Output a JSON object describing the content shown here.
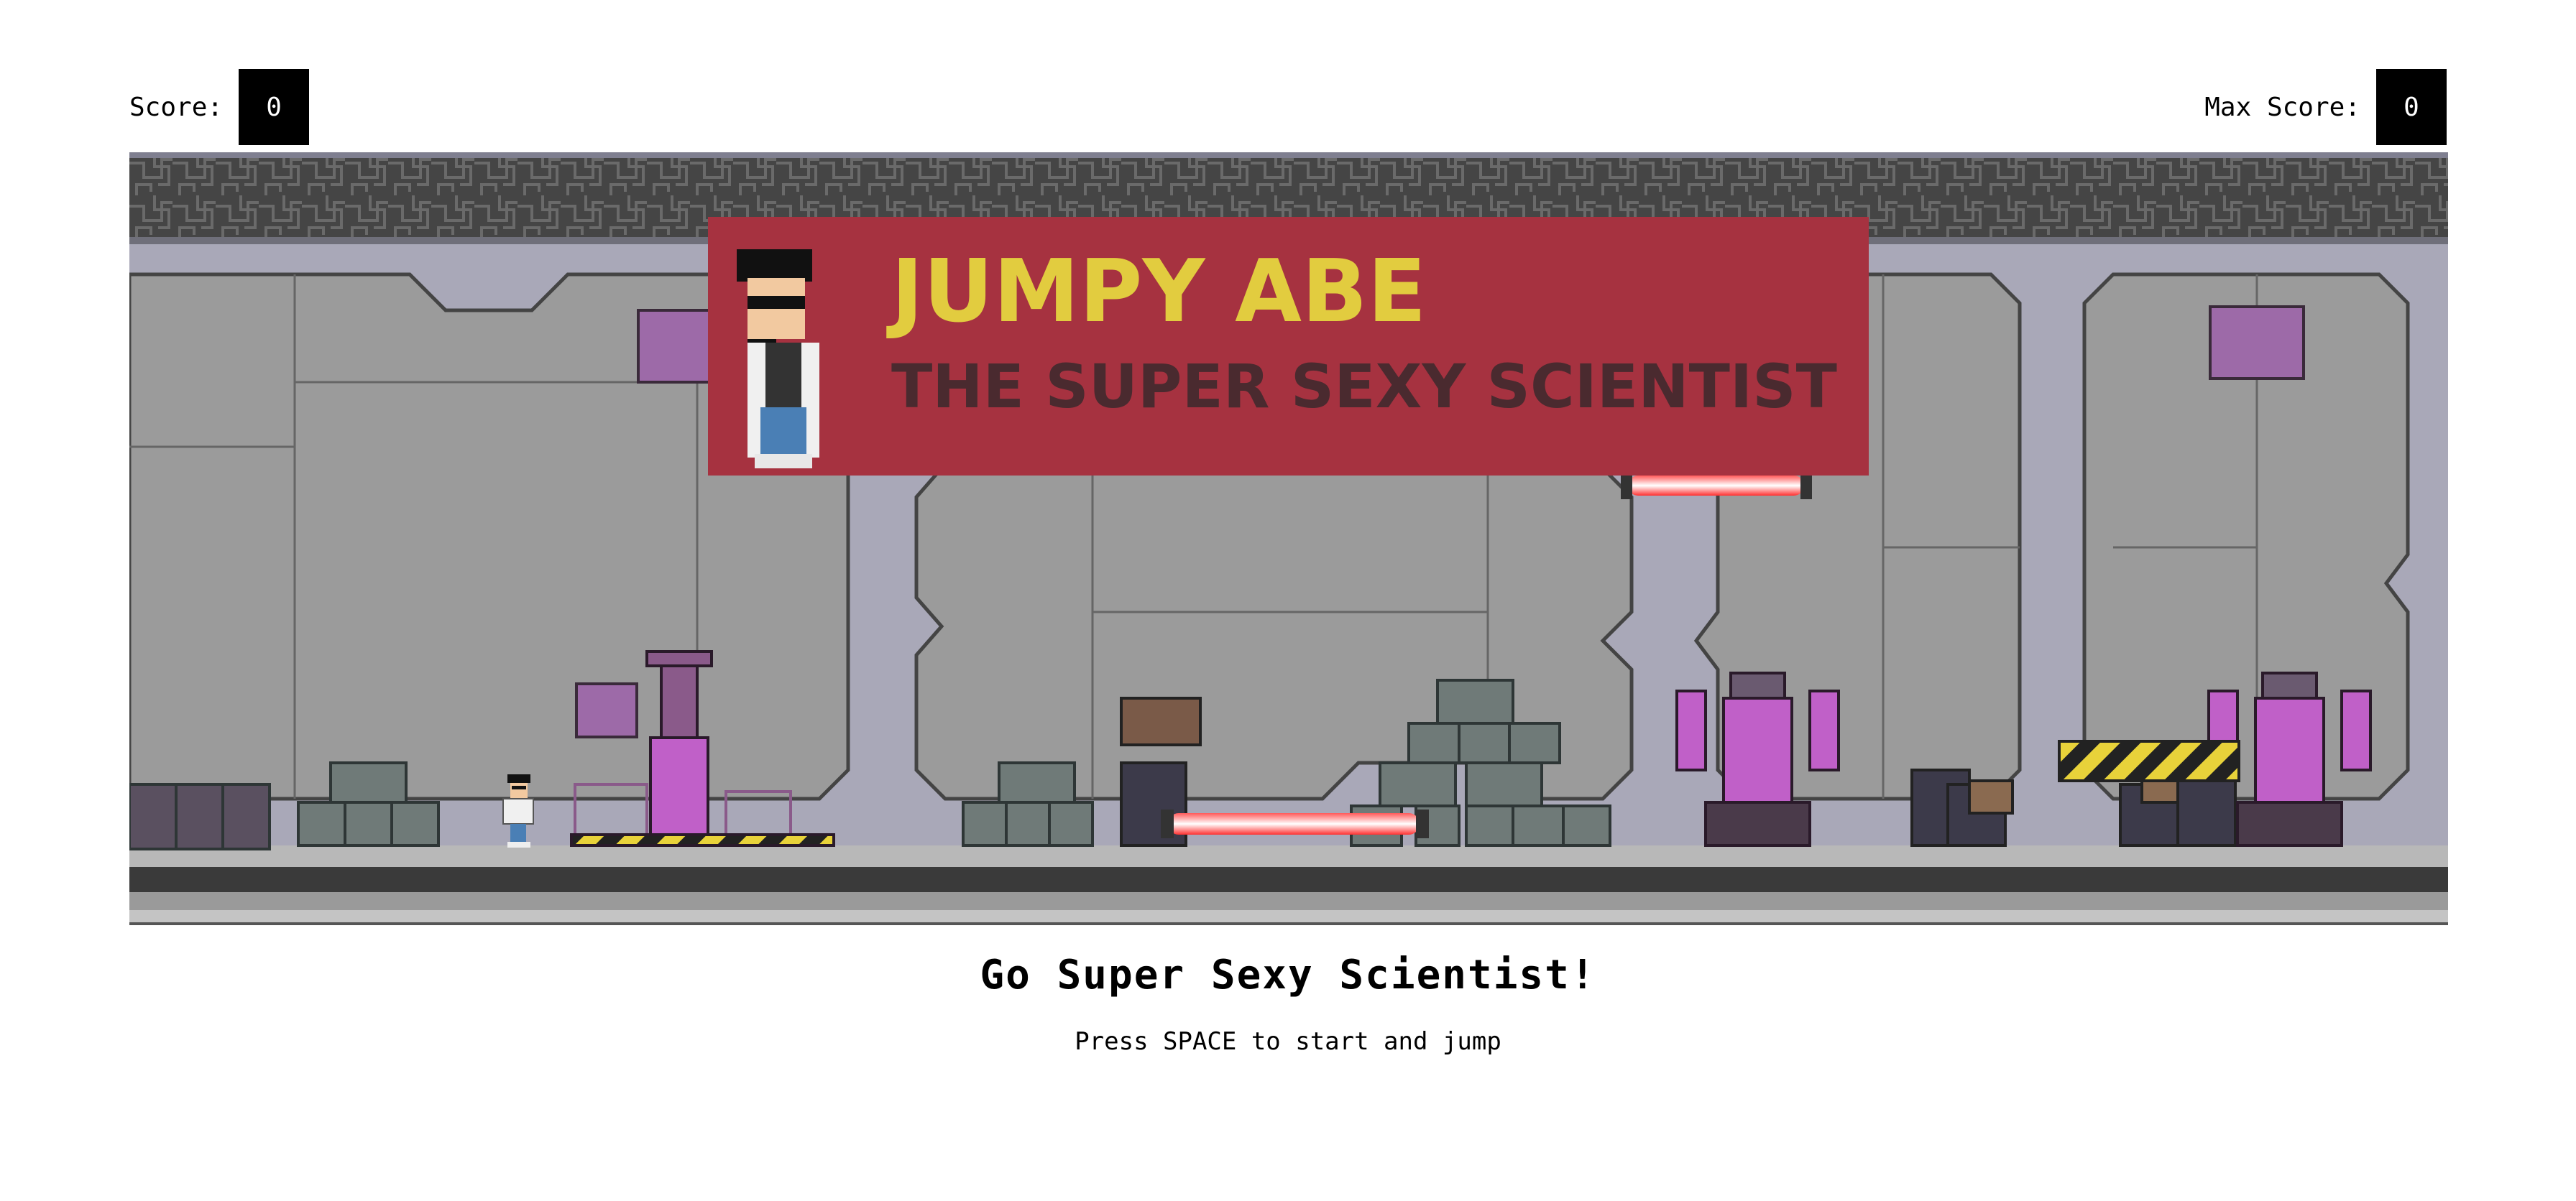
{
  "hud": {
    "score_label": "Score:",
    "score_value": "0",
    "max_label": "Max Score:",
    "max_value": "0"
  },
  "banner": {
    "title": "JUMPY ABE",
    "subtitle": "THE SUPER SEXY SCIENTIST"
  },
  "messages": {
    "headline": "Go Super Sexy Scientist!",
    "instructions": "Press SPACE to start and jump"
  },
  "colors": {
    "banner_bg": "#a63240",
    "banner_title": "#e2cc3f",
    "banner_subtitle": "#4a2a2f",
    "wall": "#a9a8b8",
    "panel": "#9a9a9a",
    "laser": "#ff3a3a",
    "tank": "#c060c8"
  }
}
